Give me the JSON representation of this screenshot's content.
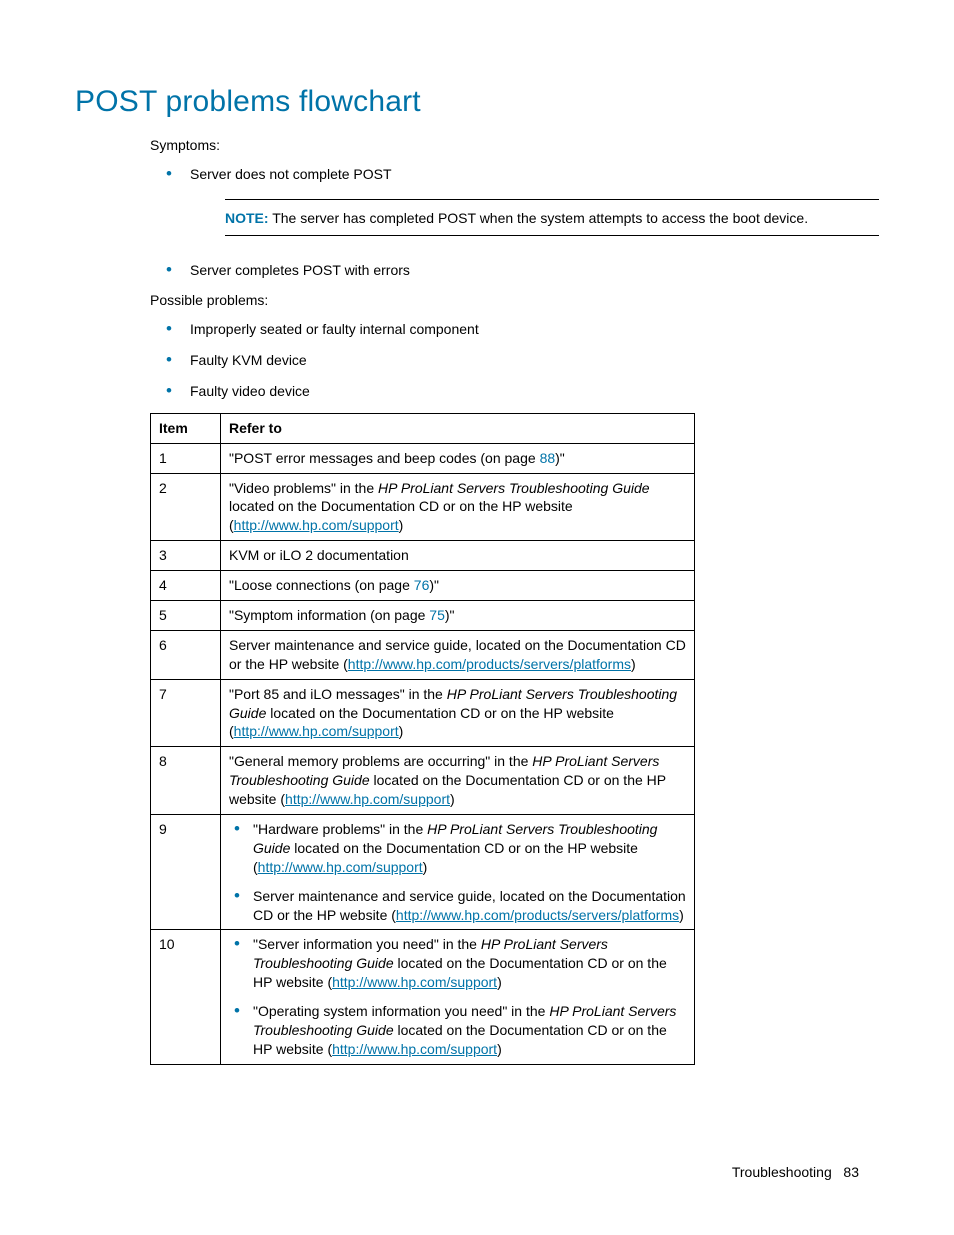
{
  "title": "POST problems flowchart",
  "symptoms_label": "Symptoms:",
  "symptom_item_1": "Server does not complete POST",
  "note_label": "NOTE:",
  "note_body": " The server has completed POST when the system attempts to access the boot device.",
  "symptom_item_2": "Server completes POST with errors",
  "possible_label": "Possible problems:",
  "problem_1": "Improperly seated or faulty internal component",
  "problem_2": "Faulty KVM device",
  "problem_3": "Faulty video device",
  "th_item": "Item",
  "th_refer": "Refer to",
  "rows": {
    "r1_no": "1",
    "r1_a": "\"POST error messages and beep codes (on page ",
    "r1_page": "88",
    "r1_b": ")\"",
    "r2_no": "2",
    "r2_a": "\"Video problems\" in the ",
    "r2_guide": "HP ProLiant Servers Troubleshooting Guide",
    "r2_b": " located on the Documentation CD or on the HP website (",
    "r2_link": "http://www.hp.com/support",
    "r2_c": ")",
    "r3_no": "3",
    "r3_a": "KVM or iLO 2 documentation",
    "r4_no": "4",
    "r4_a": "\"Loose connections (on page ",
    "r4_page": "76",
    "r4_b": ")\"",
    "r5_no": "5",
    "r5_a": "\"Symptom information (on page ",
    "r5_page": "75",
    "r5_b": ")\"",
    "r6_no": "6",
    "r6_a": "Server maintenance and service guide, located on the Documentation CD or the HP website (",
    "r6_link": "http://www.hp.com/products/servers/platforms",
    "r6_b": ")",
    "r7_no": "7",
    "r7_a": "\"Port 85 and iLO messages\" in the ",
    "r7_guide": "HP ProLiant Servers Troubleshooting Guide",
    "r7_b": " located on the Documentation CD or on the HP website (",
    "r7_link": "http://www.hp.com/support",
    "r7_c": ")",
    "r8_no": "8",
    "r8_a": "\"General memory problems are occurring\" in the ",
    "r8_guide": "HP ProLiant Servers Troubleshooting Guide",
    "r8_b": " located on the Documentation CD or on the HP website (",
    "r8_link": "http://www.hp.com/support",
    "r8_c": ")",
    "r9_no": "9",
    "r9_li1_a": "\"Hardware problems\" in the ",
    "r9_li1_guide": "HP ProLiant Servers Troubleshooting Guide",
    "r9_li1_b": " located on the Documentation CD or on the HP website (",
    "r9_li1_link": "http://www.hp.com/support",
    "r9_li1_c": ")",
    "r9_li2_a": "Server maintenance and service guide, located on the Documentation CD or the HP website (",
    "r9_li2_link": "http://www.hp.com/products/servers/platforms",
    "r9_li2_b": ")",
    "r10_no": "10",
    "r10_li1_a": "\"Server information you need\" in the ",
    "r10_li1_guide": "HP ProLiant Servers Troubleshooting Guide",
    "r10_li1_b": " located on the Documentation CD or on the HP website (",
    "r10_li1_link": "http://www.hp.com/support",
    "r10_li1_c": ")",
    "r10_li2_a": "\"Operating system information you need\" in the ",
    "r10_li2_guide": "HP ProLiant Servers Troubleshooting Guide",
    "r10_li2_b": " located on the Documentation CD or on the HP website (",
    "r10_li2_link": "http://www.hp.com/support",
    "r10_li2_c": ")"
  },
  "footer_section": "Troubleshooting",
  "footer_page": "83"
}
